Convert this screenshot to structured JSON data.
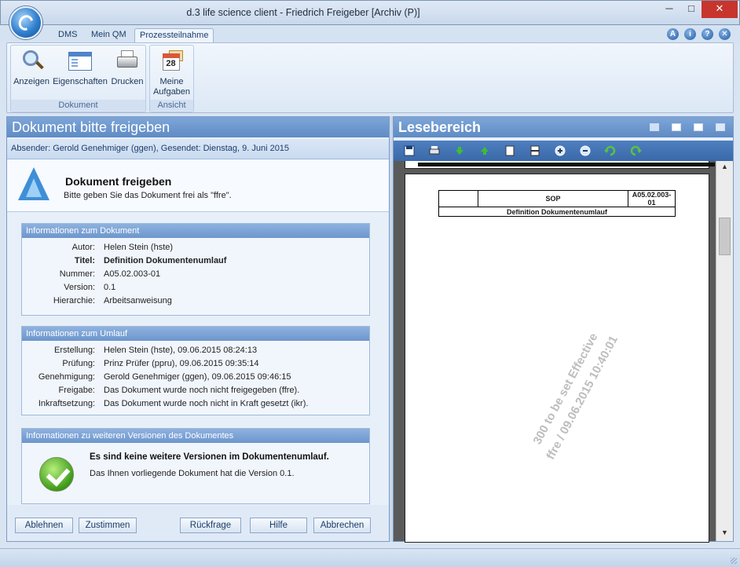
{
  "window": {
    "title": "d.3 life science client - Friedrich Freigeber [Archiv (P)]",
    "minimize": "─",
    "maximize": "□",
    "close": "✕"
  },
  "ribbon": {
    "tabs": [
      "DMS",
      "Mein QM",
      "Prozessteilnahme"
    ],
    "active_tab": "Prozessteilnahme",
    "help_icons": [
      "A",
      "i",
      "?",
      "✕"
    ],
    "groups": [
      {
        "label": "Dokument",
        "buttons": [
          {
            "label": "Anzeigen",
            "icon": "magnifier-icon"
          },
          {
            "label": "Eigenschaften",
            "icon": "properties-window-icon"
          },
          {
            "label": "Drucken",
            "icon": "printer-icon"
          }
        ]
      },
      {
        "label": "Ansicht",
        "buttons": [
          {
            "label": "Meine Aufgaben",
            "icon": "calendar-icon",
            "calendar_day": "28"
          }
        ]
      }
    ]
  },
  "left_panel": {
    "title": "Dokument bitte freigeben",
    "sender": "Absender: Gerold Genehmiger (ggen), Gesendet: Dienstag, 9. Juni 2015",
    "release": {
      "title": "Dokument freigeben",
      "subtitle": "Bitte geben Sie das Dokument frei als \"ffre\"."
    },
    "doc_info": {
      "heading": "Informationen zum Dokument",
      "rows": [
        {
          "label": "Autor:",
          "value": "Helen Stein (hste)"
        },
        {
          "label": "Titel:",
          "value": "Definition Dokumentenumlauf"
        },
        {
          "label": "Nummer:",
          "value": "A05.02.003-01"
        },
        {
          "label": "Version:",
          "value": "0.1"
        },
        {
          "label": "Hierarchie:",
          "value": "Arbeitsanweisung"
        }
      ]
    },
    "circulation_info": {
      "heading": "Informationen zum Umlauf",
      "rows": [
        {
          "label": "Erstellung:",
          "value": "Helen Stein (hste), 09.06.2015 08:24:13"
        },
        {
          "label": "Prüfung:",
          "value": "Prinz Prüfer (ppru), 09.06.2015 09:35:14"
        },
        {
          "label": "Genehmigung:",
          "value": "Gerold Genehmiger (ggen), 09.06.2015 09:46:15"
        },
        {
          "label": "Freigabe:",
          "value": "Das Dokument wurde noch nicht freigegeben (ffre)."
        },
        {
          "label": "Inkraftsetzung:",
          "value": "Das Dokument wurde noch nicht in Kraft gesetzt (ikr)."
        }
      ]
    },
    "versions_info": {
      "heading": "Informationen zu weiteren Versionen des Dokumentes",
      "title": "Es sind keine weitere Versionen im Dokumentenumlauf.",
      "subtitle": "Das Ihnen vorliegende Dokument hat die Version 0.1."
    },
    "buttons": {
      "reject": "Ablehnen",
      "agree": "Zustimmen",
      "query": "Rückfrage",
      "help": "Hilfe",
      "cancel": "Abbrechen"
    }
  },
  "right_panel": {
    "title": "Lesebereich",
    "toolbar_icons": [
      "save-icon",
      "print-icon",
      "arrow-down-icon",
      "arrow-up-icon",
      "fit-page-icon",
      "fit-width-icon",
      "zoom-in-icon",
      "zoom-out-icon",
      "rotate-left-icon",
      "rotate-right-icon"
    ],
    "document": {
      "header_center": "SOP",
      "header_right": "A05.02.003-01",
      "subtitle": "Definition Dokumentenumlauf",
      "watermark_line1": "300 to be set Effective",
      "watermark_line2": "ffre / 09.06.2015 10:40:01"
    }
  },
  "colors": {
    "panel_header": "#6d96cc",
    "close_button": "#c7352d",
    "toolbar_blue": "#3a69a8"
  }
}
